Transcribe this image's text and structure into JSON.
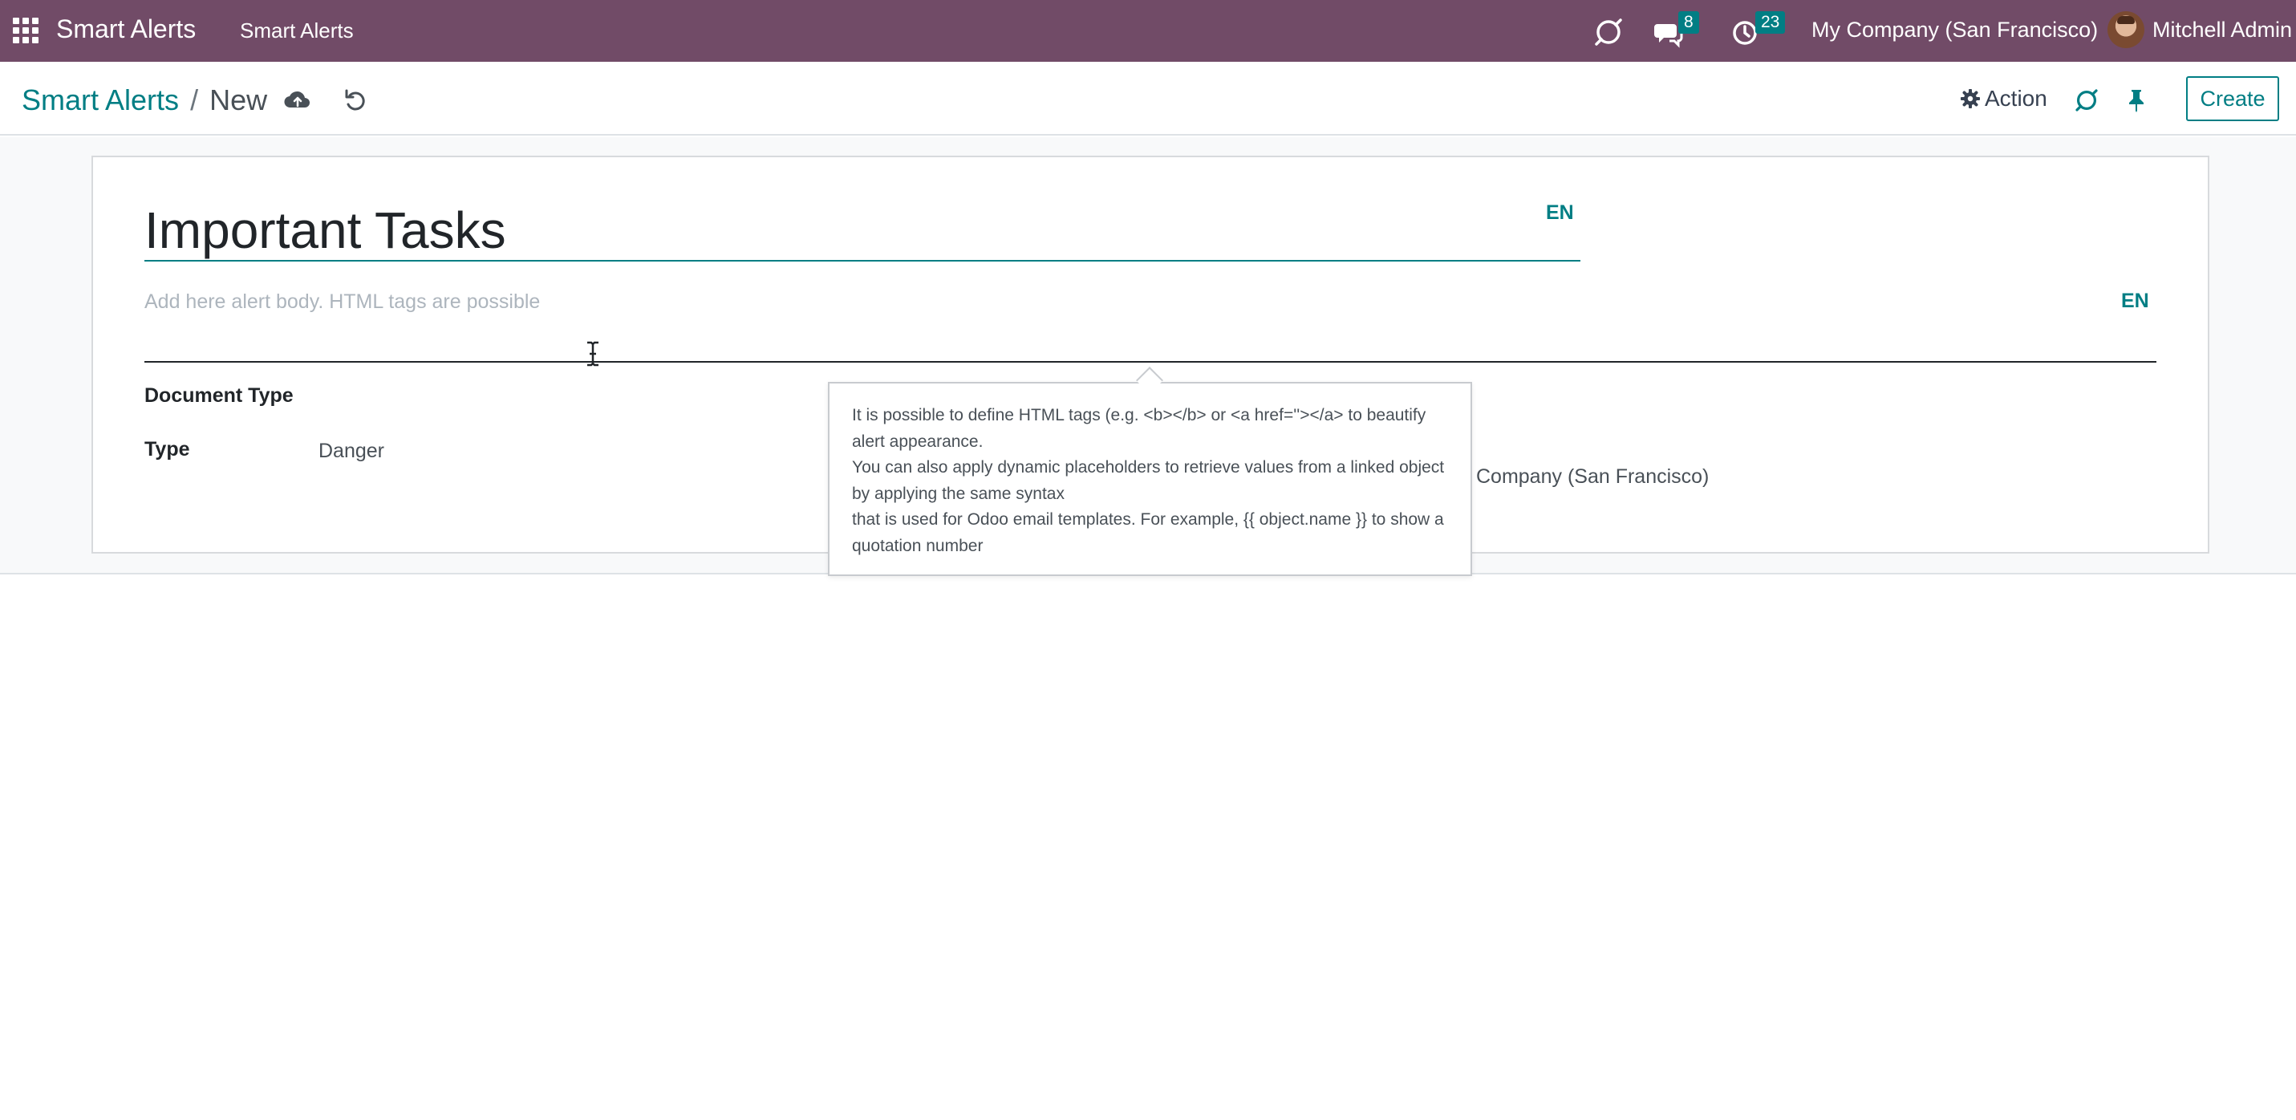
{
  "navbar": {
    "app_name": "Smart Alerts",
    "menu_item": "Smart Alerts",
    "messages_count": "8",
    "activities_count": "23",
    "company": "My Company (San Francisco)",
    "user": "Mitchell Admin"
  },
  "breadcrumb": {
    "parent": "Smart Alerts",
    "separator": "/",
    "current": "New"
  },
  "control_panel": {
    "action_label": "Action",
    "create_label": "Create"
  },
  "form": {
    "title_value": "Important Tasks",
    "title_lang": "EN",
    "body_placeholder": "Add here alert body. HTML tags are possible",
    "body_lang": "EN",
    "document_type_label": "Document Type",
    "type_label": "Type",
    "type_value": "Danger",
    "company_value_partial": "Company (San Francisco)"
  },
  "tooltip": {
    "line1": "It is possible to define HTML tags (e.g. <b></b> or <a href=''></a> to beautify alert appearance.",
    "line2": "You can also apply dynamic placeholders to retrieve values from a linked object by applying the same syntax",
    "line3": "that is used for Odoo email templates. For example, {{ object.name }} to show a quotation number"
  },
  "colors": {
    "navbar_bg": "#714b67",
    "accent": "#017e84"
  }
}
